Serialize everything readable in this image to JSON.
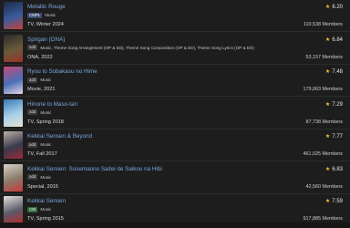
{
  "entries": [
    {
      "title": "Metallic Rouge",
      "badge": "CMPL",
      "badge_kind": "status",
      "theme": "Music",
      "info": "TV, Winter 2024",
      "score": "6.20",
      "members": "110,538 Members",
      "colors": [
        "#1b2a4a",
        "#3b5b9a",
        "#c8423a"
      ]
    },
    {
      "title": "Sprigan (ONA)",
      "badge": "add",
      "badge_kind": "add",
      "theme": "Music, Theme Song Arrangement (OP & ED), Theme Song Composition (OP & ED), Theme Song Lyrics (OP & ED)",
      "info": "ONA, 2022",
      "score": "6.84",
      "members": "53,157 Members",
      "colors": [
        "#2a2a2a",
        "#6a5a3a",
        "#9a2f28"
      ]
    },
    {
      "title": "Ryuu to Sobakasu no Hime",
      "badge": "add",
      "badge_kind": "add",
      "theme": "Music",
      "info": "Movie, 2021",
      "score": "7.48",
      "members": "179,063 Members",
      "colors": [
        "#c44a7a",
        "#4a6fb8",
        "#e6d3e0"
      ]
    },
    {
      "title": "Hinone to Maso-tan",
      "badge": "add",
      "badge_kind": "add",
      "theme": "Music",
      "info": "TV, Spring 2018",
      "score": "7.29",
      "members": "87,738 Members",
      "colors": [
        "#3a7ab8",
        "#a8d0e8",
        "#e8e2d0"
      ]
    },
    {
      "title": "Kekkai Sensen & Beyond",
      "badge": "add",
      "badge_kind": "add",
      "theme": "Music",
      "info": "TV, Fall 2017",
      "score": "7.77",
      "members": "461,025 Members",
      "colors": [
        "#b8b0a8",
        "#3a3a4a",
        "#9a2a3a"
      ]
    },
    {
      "title": "Kekkai Sensen: Sosemaono Saitei de Saikou na Hibi",
      "badge": "add",
      "badge_kind": "add",
      "theme": "Music",
      "info": "Special, 2015",
      "score": "6.83",
      "members": "42,560 Members",
      "colors": [
        "#d8d0c8",
        "#8a7a6a",
        "#c83a3a"
      ]
    },
    {
      "title": "Kekkai Sensen",
      "badge": "CW",
      "badge_kind": "cw",
      "theme": "Music",
      "info": "TV, Spring 2015",
      "score": "7.59",
      "members": "917,885 Members",
      "colors": [
        "#e8e2da",
        "#5a5a6a",
        "#b82a2a"
      ]
    }
  ]
}
